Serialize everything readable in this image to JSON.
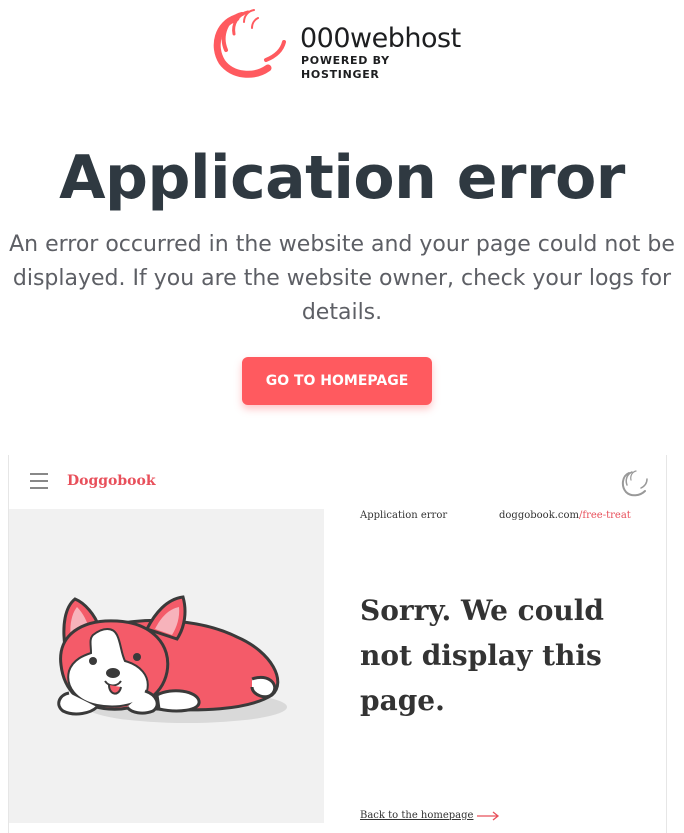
{
  "logo": {
    "name": "000webhost",
    "subtitle": "POWERED BY HOSTINGER",
    "accent": "#ff5a5f"
  },
  "error": {
    "title": "Application error",
    "description": "An error occurred in the website and your page could not be displayed. If you are the website owner, check your logs for details.",
    "button_label": "GO TO HOMEPAGE",
    "button_color": "#ff5a5f"
  },
  "preview": {
    "menu_icon": "hamburger-icon",
    "brand": "Doggobook",
    "brand_color": "#e8505b",
    "breadcrumb": "Application error",
    "url_domain": "doggobook.com",
    "url_path": "/free-treat",
    "heading": "Sorry. We could not display this page.",
    "back_link": "Back to the homepage",
    "illustration": "corgi-dog-illustration"
  }
}
